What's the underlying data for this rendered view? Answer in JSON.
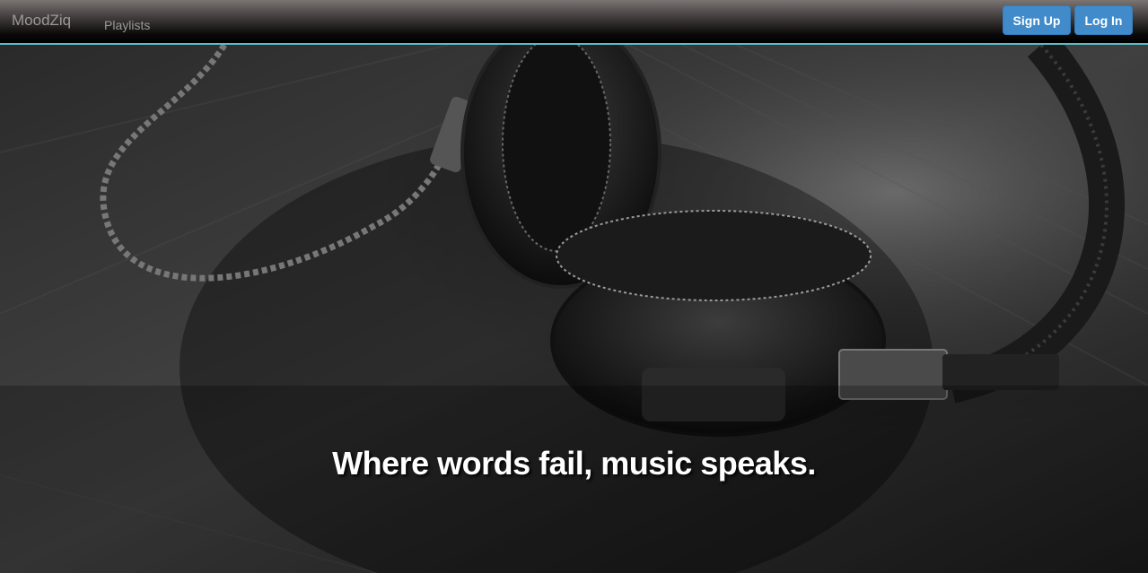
{
  "navbar": {
    "brand": "MoodZiq",
    "links": [
      {
        "label": "Playlists"
      }
    ],
    "signup_label": "Sign Up",
    "login_label": "Log In",
    "accent_color": "#5bbcc9",
    "button_color": "#428bca"
  },
  "hero": {
    "tagline": "Where words fail, music speaks.",
    "background_image": "headphones-photo"
  }
}
